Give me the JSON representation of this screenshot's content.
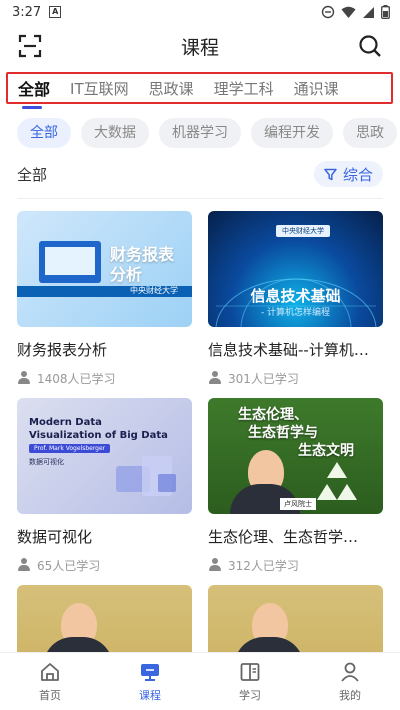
{
  "status_bar": {
    "time": "3:27",
    "icon_a": "A"
  },
  "header": {
    "title": "课程"
  },
  "tabs": [
    {
      "label": "全部",
      "active": true
    },
    {
      "label": "IT互联网",
      "active": false
    },
    {
      "label": "思政课",
      "active": false
    },
    {
      "label": "理学工科",
      "active": false
    },
    {
      "label": "通识课",
      "active": false
    }
  ],
  "chips": [
    {
      "label": "全部",
      "active": true
    },
    {
      "label": "大数据",
      "active": false
    },
    {
      "label": "机器学习",
      "active": false
    },
    {
      "label": "编程开发",
      "active": false
    },
    {
      "label": "思政",
      "active": false
    }
  ],
  "filter": {
    "label": "全部",
    "sort_label": "综合"
  },
  "courses": [
    {
      "title": "财务报表分析",
      "learners": "1408人已学习",
      "thumb_text": [
        "财务报表",
        "分析"
      ],
      "thumb_sub": "中央财经大学"
    },
    {
      "title": "信息技术基础--计算机…",
      "learners": "301人已学习",
      "thumb_text": "信息技术基础",
      "thumb_sub": "- 计算机怎样编程",
      "thumb_tag": "中央财经大学"
    },
    {
      "title": "数据可视化",
      "learners": "65人已学习",
      "thumb_text": [
        "Modern Data",
        "Visualization of Big Data"
      ],
      "thumb_tag": "Prof. Mark Vogelsberger",
      "thumb_sub": "数据可视化"
    },
    {
      "title": "生态伦理、生态哲学…",
      "learners": "312人已学习",
      "thumb_text": [
        "生态伦理、",
        "生态哲学与",
        "生态文明"
      ],
      "thumb_tag": "卢风院士"
    },
    {
      "title": "",
      "learners": ""
    },
    {
      "title": "",
      "learners": ""
    }
  ],
  "nav": [
    {
      "label": "首页",
      "icon": "home-icon",
      "active": false
    },
    {
      "label": "课程",
      "icon": "course-icon",
      "active": true
    },
    {
      "label": "学习",
      "icon": "book-icon",
      "active": false
    },
    {
      "label": "我的",
      "icon": "person-icon",
      "active": false
    }
  ],
  "colors": {
    "accent": "#3a66e0",
    "highlight_box": "#e02c2c"
  }
}
